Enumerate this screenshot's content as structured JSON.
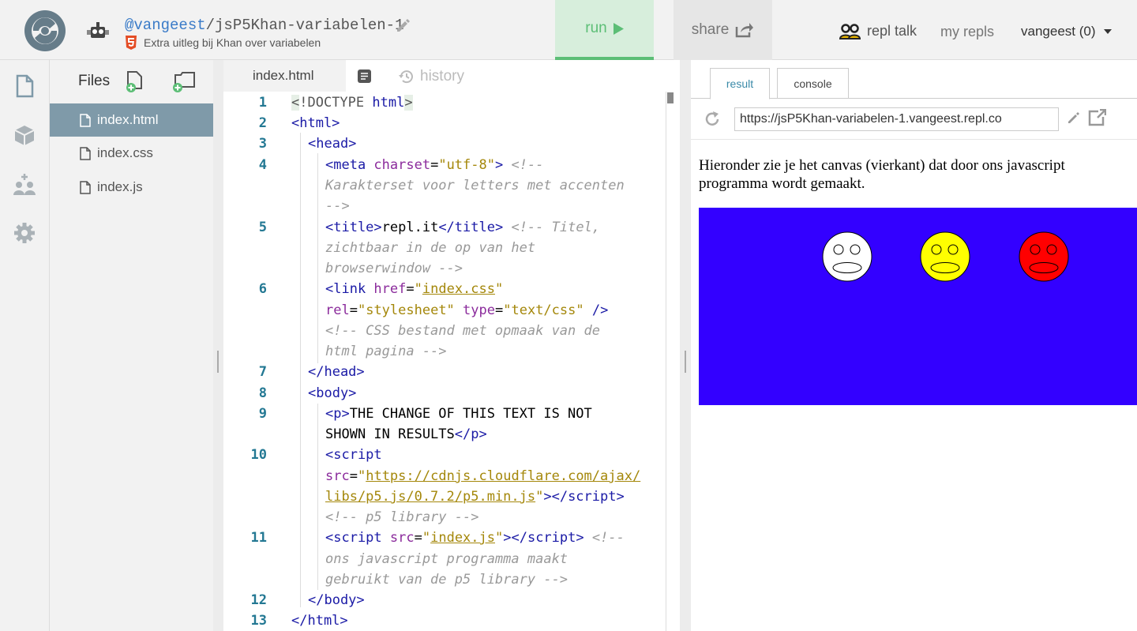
{
  "header": {
    "user": "@vangeest",
    "repl_name": "/jsP5Khan-variabelen-1",
    "description": "Extra uitleg bij Khan over variabelen",
    "run_label": "run",
    "share_label": "share",
    "repl_talk_label": "repl talk",
    "my_repls_label": "my repls",
    "account_label": "vangeest (0)"
  },
  "files": {
    "title": "Files",
    "items": [
      {
        "name": "index.html",
        "active": true
      },
      {
        "name": "index.css",
        "active": false
      },
      {
        "name": "index.js",
        "active": false
      }
    ]
  },
  "editor": {
    "active_tab": "index.html",
    "history_label": "history",
    "line_numbers": [
      "1",
      "2",
      "3",
      "4",
      "5",
      "6",
      "7",
      "8",
      "9",
      "10",
      "11",
      "12",
      "13"
    ]
  },
  "result": {
    "tab_result": "result",
    "tab_console": "console",
    "url": "https://jsP5Khan-variabelen-1.vangeest.repl.co",
    "output_text": "Hieronder zie je het canvas (vierkant) dat door ons javascript programma wordt gemaakt."
  },
  "canvas": {
    "background": "#3300ff",
    "faces": [
      {
        "color": "#ffffff"
      },
      {
        "color": "#ffff00"
      },
      {
        "color": "#ff0000"
      }
    ]
  },
  "colors": {
    "run_green": "#5cbe76",
    "run_bg": "#d7eedc",
    "active_file_bg": "#7f9aa9",
    "link_blue": "#3a7bc8"
  }
}
